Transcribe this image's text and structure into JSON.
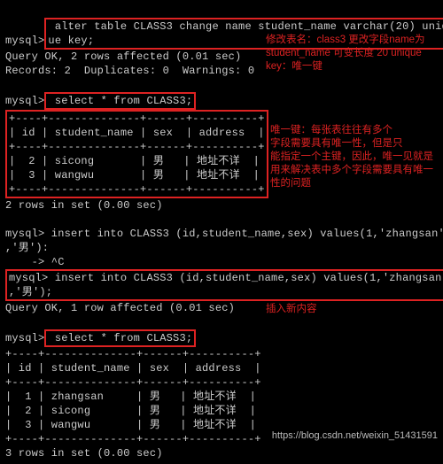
{
  "lines": {
    "l1a": "mysql>",
    "l1b": " alter table CLASS3 change name student_name varchar(20) uniq",
    "l2": "ue key;",
    "l3": "Query OK, 2 rows affected (0.01 sec)",
    "l4": "Records: 2  Duplicates: 0  Warnings: 0",
    "l5": "",
    "l6a": "mysql>",
    "l6b": " select * from CLASS3;",
    "l7": "+----+--------------+------+----------+",
    "l8": "| id | student_name | sex  | address  |",
    "l9": "+----+--------------+------+----------+",
    "l10": "|  2 | sicong       | 男   | 地址不详  |",
    "l11": "|  3 | wangwu       | 男   | 地址不详  |",
    "l12": "+----+--------------+------+----------+",
    "l13": "2 rows in set (0.00 sec)",
    "l14": "",
    "l15": "mysql> insert into CLASS3 (id,student_name,sex) values(1,'zhangsan'",
    "l16": ",'男'):",
    "l17": "    -> ^C",
    "l18a": "mysql>",
    "l18b": " insert into CLASS3 (id,student_name,sex) values(1,'zhangsan'",
    "l19": ",'男');",
    "l20": "Query OK, 1 row affected (0.01 sec)",
    "l21": "",
    "l22a": "mysql>",
    "l22b": " select * from CLASS3;",
    "l23": "+----+--------------+------+----------+",
    "l24": "| id | student_name | sex  | address  |",
    "l25": "+----+--------------+------+----------+",
    "l26": "|  1 | zhangsan     | 男   | 地址不详  |",
    "l27": "|  2 | sicong       | 男   | 地址不详  |",
    "l28": "|  3 | wangwu       | 男   | 地址不详  |",
    "l29": "+----+--------------+------+----------+",
    "l30": "3 rows in set (0.00 sec)"
  },
  "annotations": {
    "a1": "修改表名：class3 更改字段name为\nstudent_name 可变长度 20 unique\nkey：唯一键",
    "a2": "唯一键：每张表往往有多个\n字段需要具有唯一性，但是只\n能指定一个主键，因此，唯一见就是\n用来解决表中多个字段需要具有唯一\n性的问题",
    "a3": "插入新内容"
  },
  "watermark": "https://blog.csdn.net/weixin_51431591"
}
